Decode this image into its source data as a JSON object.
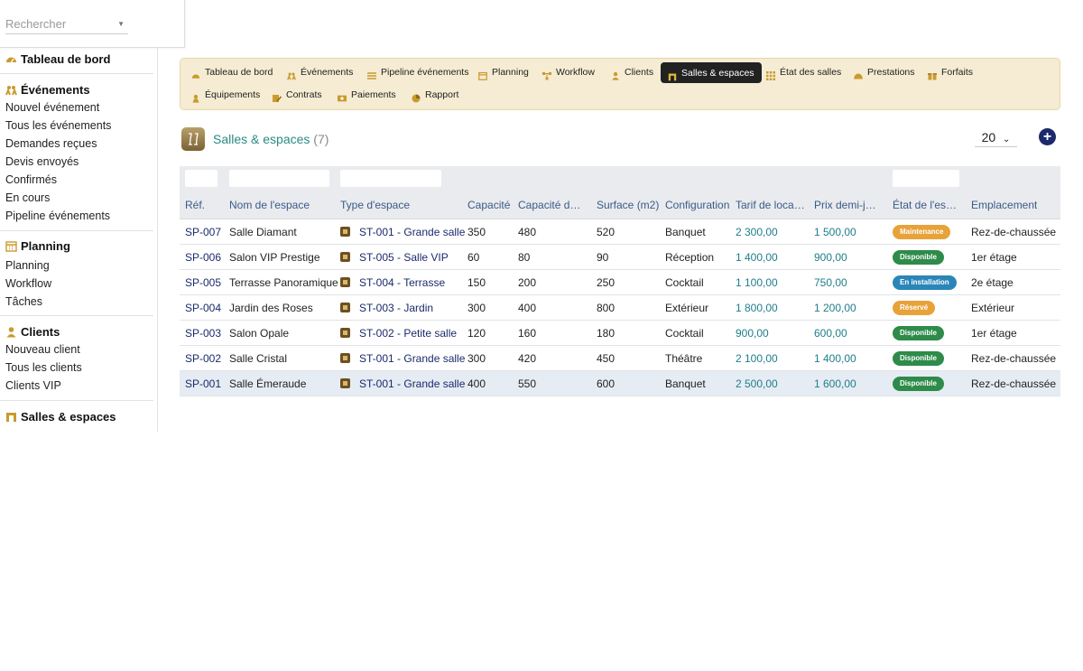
{
  "search": {
    "placeholder": "Rechercher"
  },
  "sidebar": {
    "dashboard": "Tableau de bord",
    "events": {
      "title": "Événements",
      "items": [
        "Nouvel événement",
        "Tous les événements",
        "Demandes reçues",
        "Devis envoyés",
        "Confirmés",
        "En cours",
        "Pipeline événements"
      ]
    },
    "planning": {
      "title": "Planning",
      "items": [
        "Planning",
        "Workflow",
        "Tâches"
      ]
    },
    "clients": {
      "title": "Clients",
      "items": [
        "Nouveau client",
        "Tous les clients",
        "Clients VIP"
      ]
    },
    "spaces": {
      "title": "Salles & espaces"
    }
  },
  "tabs": [
    {
      "label": "Tableau de bord",
      "icon": "dashboard-icon"
    },
    {
      "label": "Événements",
      "icon": "events-icon"
    },
    {
      "label": "Pipeline événements",
      "icon": "pipeline-icon"
    },
    {
      "label": "Planning",
      "icon": "calendar-icon"
    },
    {
      "label": "Workflow",
      "icon": "workflow-icon"
    },
    {
      "label": "Clients",
      "icon": "user-icon"
    },
    {
      "label": "Salles & espaces",
      "icon": "room-icon",
      "active": true
    },
    {
      "label": "État des salles",
      "icon": "grid-icon"
    },
    {
      "label": "Prestations",
      "icon": "service-icon"
    },
    {
      "label": "Forfaits",
      "icon": "package-icon"
    },
    {
      "label": "Équipements",
      "icon": "equipment-icon"
    },
    {
      "label": "Contrats",
      "icon": "contract-icon"
    },
    {
      "label": "Paiements",
      "icon": "payment-icon"
    },
    {
      "label": "Rapport",
      "icon": "report-icon"
    }
  ],
  "page": {
    "title": "Salles & espaces",
    "count": "(7)",
    "page_size": "20"
  },
  "table": {
    "headers": [
      "Réf.",
      "Nom de l'espace",
      "Type d'espace",
      "Capacité",
      "Capacité de…",
      "Surface (m2)",
      "Configuration",
      "Tarif de locat…",
      "Prix demi-jo…",
      "État de l'esp…",
      "Emplacement"
    ],
    "rows": [
      {
        "ref": "SP-007",
        "name": "Salle Diamant",
        "type": "ST-001 - Grande salle",
        "cap": "350",
        "cap2": "480",
        "surface": "520",
        "config": "Banquet",
        "tarif": "2 300,00",
        "prix": "1 500,00",
        "etat": "Maintenance",
        "lieu": "Rez-de-chaussée"
      },
      {
        "ref": "SP-006",
        "name": "Salon VIP Prestige",
        "type": "ST-005 - Salle VIP",
        "cap": "60",
        "cap2": "80",
        "surface": "90",
        "config": "Réception",
        "tarif": "1 400,00",
        "prix": "900,00",
        "etat": "Disponible",
        "lieu": "1er étage"
      },
      {
        "ref": "SP-005",
        "name": "Terrasse Panoramique",
        "type": "ST-004 - Terrasse",
        "cap": "150",
        "cap2": "200",
        "surface": "250",
        "config": "Cocktail",
        "tarif": "1 100,00",
        "prix": "750,00",
        "etat": "En installation",
        "lieu": "2e étage"
      },
      {
        "ref": "SP-004",
        "name": "Jardin des Roses",
        "type": "ST-003 - Jardin",
        "cap": "300",
        "cap2": "400",
        "surface": "800",
        "config": "Extérieur",
        "tarif": "1 800,00",
        "prix": "1 200,00",
        "etat": "Réservé",
        "lieu": "Extérieur"
      },
      {
        "ref": "SP-003",
        "name": "Salon Opale",
        "type": "ST-002 - Petite salle",
        "cap": "120",
        "cap2": "160",
        "surface": "180",
        "config": "Cocktail",
        "tarif": "900,00",
        "prix": "600,00",
        "etat": "Disponible",
        "lieu": "1er étage"
      },
      {
        "ref": "SP-002",
        "name": "Salle Cristal",
        "type": "ST-001 - Grande salle",
        "cap": "300",
        "cap2": "420",
        "surface": "450",
        "config": "Théâtre",
        "tarif": "2 100,00",
        "prix": "1 400,00",
        "etat": "Disponible",
        "lieu": "Rez-de-chaussée"
      },
      {
        "ref": "SP-001",
        "name": "Salle Émeraude",
        "type": "ST-001 - Grande salle",
        "cap": "400",
        "cap2": "550",
        "surface": "600",
        "config": "Banquet",
        "tarif": "2 500,00",
        "prix": "1 600,00",
        "etat": "Disponible",
        "lieu": "Rez-de-chaussée"
      }
    ]
  },
  "status_colors": {
    "Maintenance": "#e8a23a",
    "Disponible": "#2e8b4a",
    "En installation": "#2a86b8",
    "Réservé": "#e8a23a"
  }
}
